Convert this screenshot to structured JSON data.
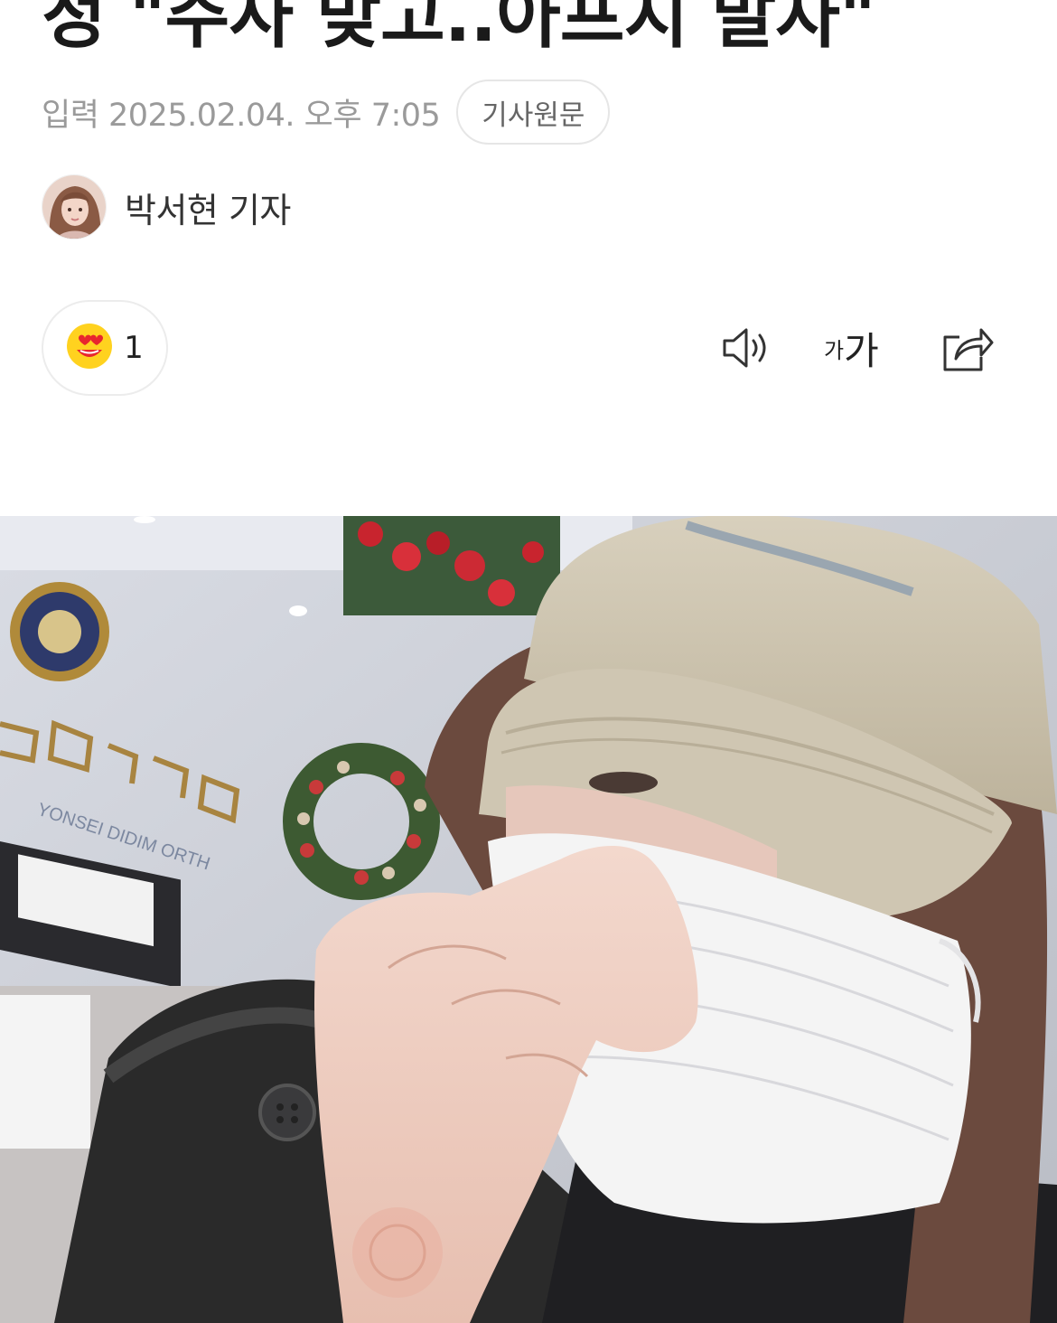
{
  "article": {
    "headline": "정 \"주사 맞고..아프지 말자\"",
    "date_text": "입력 2025.02.04. 오후 7:05",
    "original_button": "기사원문",
    "reporter_name": "박서현 기자"
  },
  "reaction": {
    "icon": "heart-eyes-emoji-icon",
    "count": "1"
  },
  "tools": {
    "speaker_icon": "speaker-icon",
    "font_small": "가",
    "font_large": "가",
    "share_icon": "share-icon"
  },
  "photo": {
    "icon": "article-photo"
  },
  "colors": {
    "meta_text": "#9a9a9a",
    "border": "#e6e6e6",
    "emoji_yellow": "#FFD21F",
    "emoji_red": "#E8262E"
  }
}
